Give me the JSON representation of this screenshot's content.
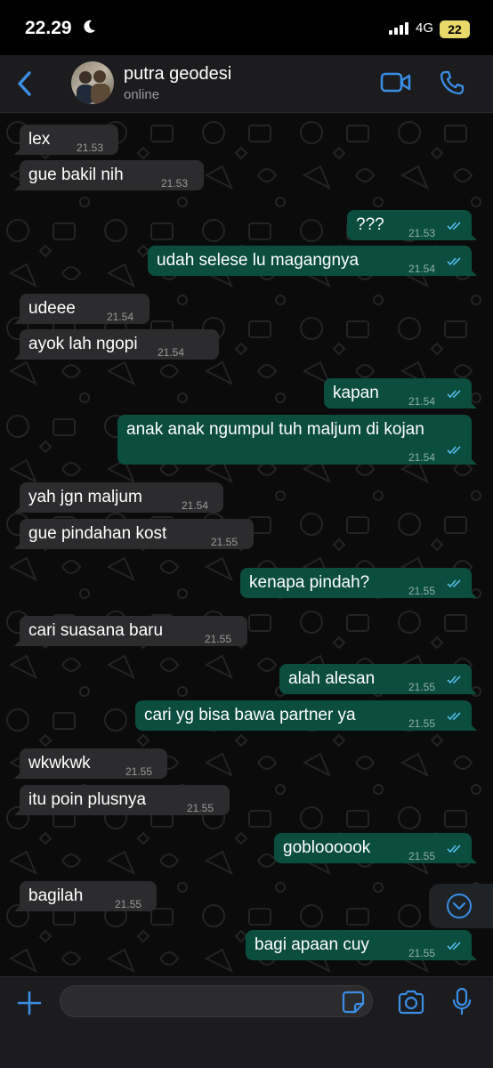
{
  "status_bar": {
    "time": "22.29",
    "network": "4G",
    "battery": "22"
  },
  "header": {
    "contact_name": "putra geodesi",
    "status": "online"
  },
  "messages": [
    {
      "dir": "in",
      "text": "lex",
      "time": "21.53"
    },
    {
      "dir": "in",
      "text": "gue bakil nih",
      "time": "21.53"
    },
    {
      "dir": "out",
      "text": "???",
      "time": "21.53"
    },
    {
      "dir": "out",
      "text": "udah selese lu magangnya",
      "time": "21.54"
    },
    {
      "dir": "in",
      "text": "udeee",
      "time": "21.54"
    },
    {
      "dir": "in",
      "text": "ayok lah ngopi",
      "time": "21.54"
    },
    {
      "dir": "out",
      "text": "kapan",
      "time": "21.54"
    },
    {
      "dir": "out",
      "text": "anak anak ngumpul tuh maljum di kojan",
      "time": "21.54"
    },
    {
      "dir": "in",
      "text": "yah jgn maljum",
      "time": "21.54"
    },
    {
      "dir": "in",
      "text": "gue pindahan kost",
      "time": "21.55"
    },
    {
      "dir": "out",
      "text": "kenapa pindah?",
      "time": "21.55"
    },
    {
      "dir": "in",
      "text": "cari suasana baru",
      "time": "21.55"
    },
    {
      "dir": "out",
      "text": "alah alesan",
      "time": "21.55"
    },
    {
      "dir": "out",
      "text": "cari yg bisa bawa partner ya",
      "time": "21.55"
    },
    {
      "dir": "in",
      "text": "wkwkwk",
      "time": "21.55"
    },
    {
      "dir": "in",
      "text": "itu poin plusnya",
      "time": "21.55"
    },
    {
      "dir": "out",
      "text": "gobloooook",
      "time": "21.55"
    },
    {
      "dir": "in",
      "text": "bagilah",
      "time": "21.55"
    },
    {
      "dir": "out",
      "text": "bagi apaan cuy",
      "time": "21.55"
    }
  ],
  "composer": {
    "input_value": ""
  },
  "icons": {
    "back": "chevron-left-icon",
    "video": "video-camera-icon",
    "call": "phone-icon",
    "plus": "plus-icon",
    "sticker": "sticker-icon",
    "camera": "camera-icon",
    "mic": "microphone-icon",
    "scroll": "chevron-down-circle-icon",
    "read": "double-check-icon"
  },
  "colors": {
    "accent": "#3a8ee6",
    "outgoing_bubble": "#0b4d3f",
    "incoming_bubble": "#2c2c2e",
    "read_ticks": "#53bdeb"
  }
}
